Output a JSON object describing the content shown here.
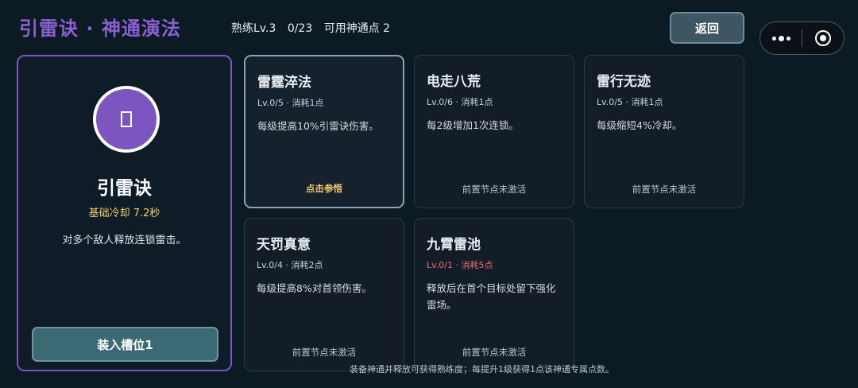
{
  "header": {
    "title": "引雷诀 · 神通演法",
    "proficiency": "熟练Lv.3",
    "progress": "0/23",
    "points": "可用神通点 2",
    "back_label": "返回"
  },
  "skill": {
    "icon": "skill-glyph-icon",
    "name": "引雷诀",
    "cooldown": "基础冷却 7.2秒",
    "description": "对多个敌人释放连锁雷击。",
    "equip_label": "装入槽位1"
  },
  "nodes": [
    {
      "title": "雷霆淬法",
      "meta": "Lv.0/5 · 消耗1点",
      "desc": "每级提高10%引雷诀伤害。",
      "status": "点击参悟"
    },
    {
      "title": "电走八荒",
      "meta": "Lv.0/6 · 消耗1点",
      "desc": "每2级增加1次连锁。",
      "status": "前置节点未激活"
    },
    {
      "title": "雷行无迹",
      "meta": "Lv.0/5 · 消耗1点",
      "desc": "每级缩短4%冷却。",
      "status": "前置节点未激活"
    },
    {
      "title": "天罚真意",
      "meta": "Lv.0/4 · 消耗2点",
      "desc": "每级提高8%对首领伤害。",
      "status": "前置节点未激活"
    },
    {
      "title": "九霄雷池",
      "meta": "Lv.0/1 · 消耗5点",
      "desc": "释放后在首个目标处留下强化雷场。",
      "status": "前置节点未激活"
    }
  ],
  "footer": "装备神通并释放可获得熟练度；每提升1级获得1点该神通专属点数。",
  "colors": {
    "accent": "#8a5fd0",
    "highlight": "#f2c96a",
    "warning": "#ea6e73",
    "background": "#0c1a24"
  }
}
